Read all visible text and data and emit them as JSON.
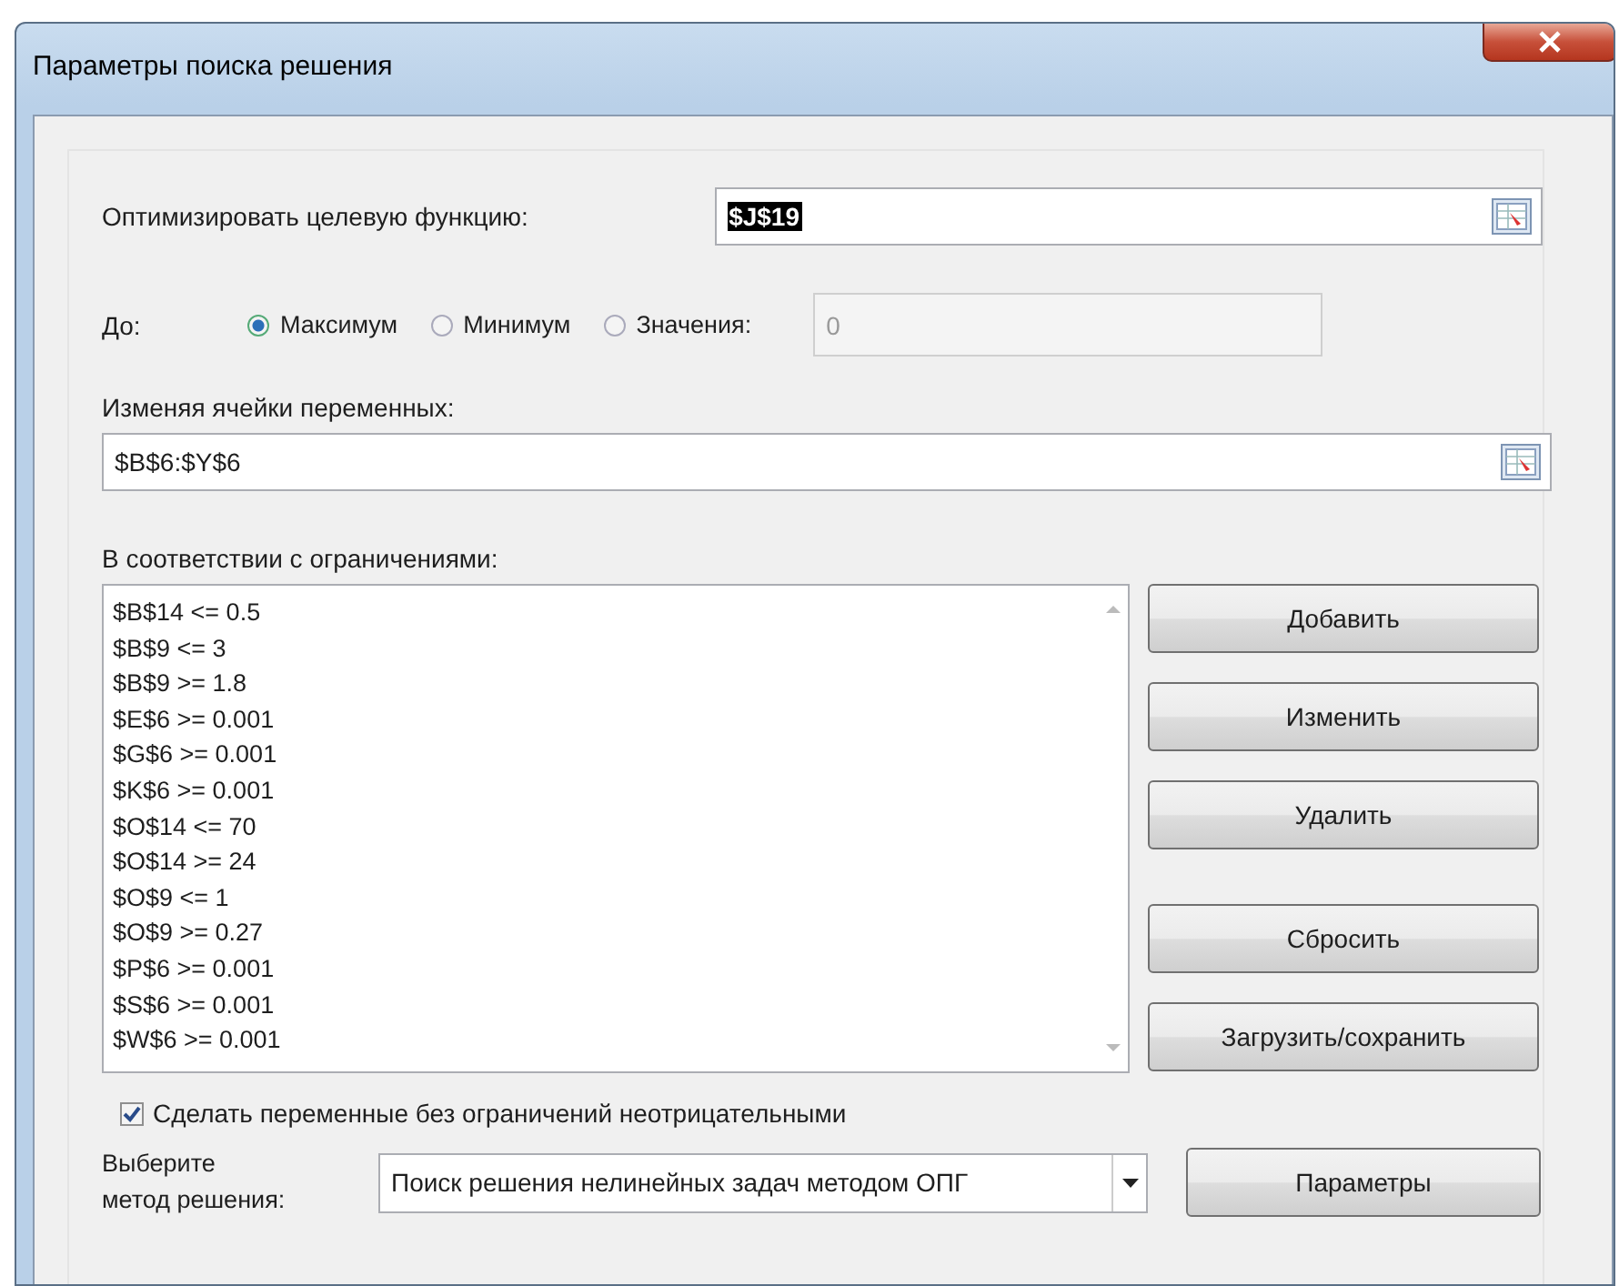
{
  "window": {
    "title": "Параметры поиска решения"
  },
  "objective": {
    "label": "Оптимизировать целевую функцию:",
    "value": "$J$19",
    "highlighted": true
  },
  "target": {
    "label": "До:",
    "options": [
      {
        "label": "Максимум",
        "selected": true
      },
      {
        "label": "Минимум",
        "selected": false
      },
      {
        "label": "Значения:",
        "selected": false
      }
    ],
    "value_field": {
      "value": "0",
      "disabled": true
    }
  },
  "variables": {
    "label": "Изменяя ячейки переменных:",
    "value": "$B$6:$Y$6"
  },
  "constraints": {
    "label": "В соответствии с ограничениями:",
    "items": [
      "$B$14 <= 0.5",
      "$B$9 <= 3",
      "$B$9 >= 1.8",
      "$E$6 >= 0.001",
      "$G$6 >= 0.001",
      "$K$6 >= 0.001",
      "$O$14 <= 70",
      "$O$14 >= 24",
      "$O$9 <= 1",
      "$O$9 >= 0.27",
      "$P$6 >= 0.001",
      "$S$6 >= 0.001",
      "$W$6 >= 0.001"
    ]
  },
  "constraint_buttons": [
    {
      "label": "Добавить"
    },
    {
      "label": "Изменить"
    },
    {
      "label": "Удалить"
    },
    {
      "label": "Сбросить"
    },
    {
      "label": "Загрузить/сохранить"
    }
  ],
  "nonnegative": {
    "label": "Сделать переменные без ограничений неотрицательными",
    "checked": true
  },
  "method": {
    "label": "Выберите\nметод решения:",
    "value": "Поиск решения нелинейных задач методом ОПГ"
  },
  "options_button": {
    "label": "Параметры"
  }
}
